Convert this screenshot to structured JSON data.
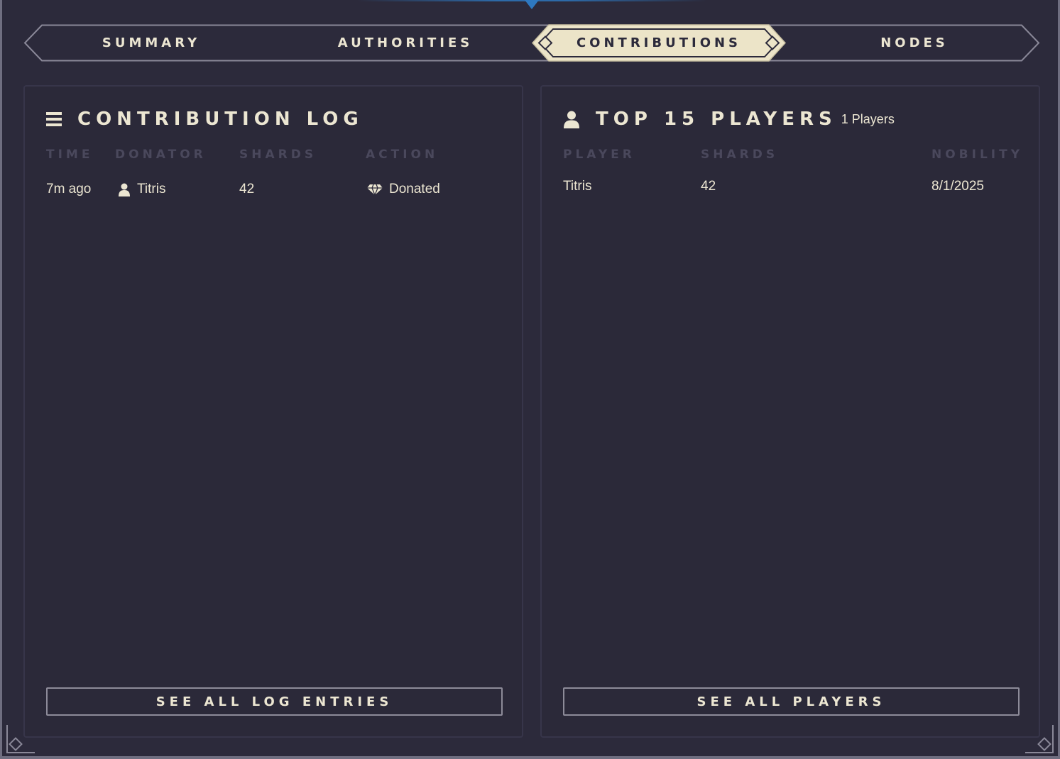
{
  "tabs": {
    "summary": "SUMMARY",
    "authorities": "AUTHORITIES",
    "contributions": "CONTRIBUTIONS",
    "nodes": "NODES",
    "active": "CONTRIBUTIONS"
  },
  "colors": {
    "background": "#2c2a3b",
    "text": "#ece6d2",
    "active_tab": "#ece4c8",
    "header_muted": "#4a485c",
    "accent_blue": "#2e78c0"
  },
  "contribution_log": {
    "title": "CONTRIBUTION LOG",
    "icon": "list-icon",
    "columns": [
      "TIME",
      "DONATOR",
      "SHARDS",
      "ACTION"
    ],
    "rows": [
      {
        "time": "7m ago",
        "donator": "Titris",
        "donator_icon": "user-icon",
        "shards": "42",
        "action": "Donated",
        "action_icon": "gem-icon"
      }
    ],
    "button": "SEE ALL LOG ENTRIES"
  },
  "top_players": {
    "title": "TOP 15 PLAYERS",
    "icon": "user-icon",
    "count_label": "1 Players",
    "columns": [
      "PLAYER",
      "SHARDS",
      "NOBILITY"
    ],
    "rows": [
      {
        "player": "Titris",
        "shards": "42",
        "nobility": "8/1/2025"
      }
    ],
    "button": "SEE ALL PLAYERS"
  }
}
